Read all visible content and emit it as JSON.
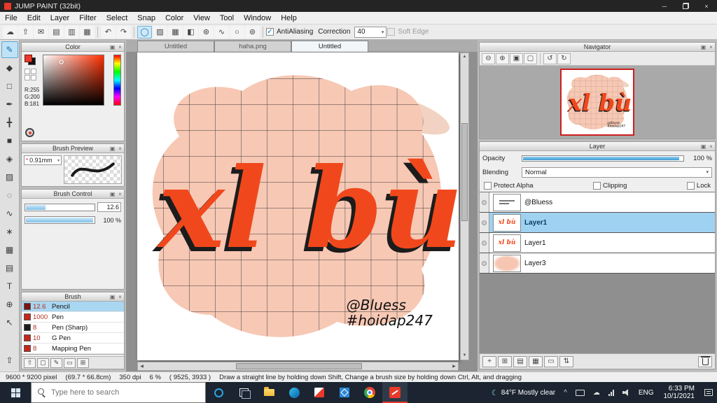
{
  "titlebar": {
    "title": "JUMP PAINT (32bit)"
  },
  "menu": [
    "File",
    "Edit",
    "Layer",
    "Filter",
    "Select",
    "Snap",
    "Color",
    "View",
    "Tool",
    "Window",
    "Help"
  ],
  "toolbar": {
    "antialiasing": "AntiAliasing",
    "correction": "Correction",
    "correction_value": "40",
    "soft_edge": "Soft Edge"
  },
  "tabs": [
    "Untitled",
    "haha.png",
    "Untitled"
  ],
  "panels": {
    "color": {
      "title": "Color",
      "r": "R:255",
      "g": "G:200",
      "b": "B:181"
    },
    "brush_preview": {
      "title": "Brush Preview",
      "size": "0.91mm"
    },
    "brush_control": {
      "title": "Brush Control",
      "size_value": "12.6",
      "opacity_value": "100 %"
    },
    "brush": {
      "title": "Brush",
      "items": [
        {
          "size": "12.6",
          "name": "Pencil"
        },
        {
          "size": "1000",
          "name": "Pen"
        },
        {
          "size": "8",
          "name": "Pen (Sharp)"
        },
        {
          "size": "10",
          "name": "G Pen"
        },
        {
          "size": "8",
          "name": "Mapping Pen"
        }
      ]
    },
    "navigator": {
      "title": "Navigator"
    },
    "layer": {
      "title": "Layer",
      "opacity_label": "Opacity",
      "opacity_value": "100 %",
      "blending_label": "Blending",
      "blending_value": "Normal",
      "protect_alpha": "Protect Alpha",
      "clipping": "Clipping",
      "lock": "Lock",
      "layers": [
        {
          "name": "@Bluess"
        },
        {
          "name": "Layer1"
        },
        {
          "name": "Layer1"
        },
        {
          "name": "Layer3"
        }
      ]
    }
  },
  "canvas": {
    "lettering": "xl bù",
    "signature1": "@Bluess",
    "signature2": "#hoidap247"
  },
  "statusbar": {
    "size": "9600 * 9200 pixel",
    "cm": "(69.7 * 66.8cm)",
    "dpi": "350 dpi",
    "zoom": "6 %",
    "coords": "( 9525, 3933 )",
    "hint": "Draw a straight line by holding down Shift, Change a brush size by holding down Ctrl, Alt, and dragging"
  },
  "taskbar": {
    "search_placeholder": "Type here to search",
    "weather": "84°F Mostly clear",
    "lang": "ENG",
    "time": "6:33 PM",
    "date": "10/1/2021"
  },
  "icons": {
    "cloud": "☁",
    "export": "⇧",
    "mail": "✉",
    "grid_a": "▤",
    "grid_b": "▥",
    "grid_c": "▦",
    "undo": "↶",
    "redo": "↷",
    "stabilizer": "◯",
    "gradient": "▨",
    "tone": "▦",
    "mirror": "◧",
    "material": "⊛",
    "curve": "∿",
    "ellipse": "○",
    "dial": "⊚",
    "check": "✓",
    "dropdown": "▾",
    "spin": "▾",
    "star": "*",
    "popout": "▣",
    "close": "×",
    "zoom_out": "⊖",
    "zoom_in": "⊕",
    "fit": "▣",
    "actual": "▢",
    "rotate_ccw": "↺",
    "rotate_cw": "↻",
    "up": "▲",
    "down": "▼",
    "left": "◀",
    "right": "▶",
    "add": "+",
    "folder_add": "⊞",
    "dup": "▤",
    "mat": "▦",
    "fold": "▭",
    "order": "⇅",
    "minimize": "─",
    "close_win": "×",
    "bf_up": "⇧",
    "bf_new": "▢",
    "bf_edit": "✎",
    "bf_doc": "▭",
    "bf_folder": "⊞",
    "moon": "☾",
    "chevron": "^",
    "tools": {
      "brush": "✎",
      "eraser": "◆",
      "select_rect": "□",
      "pen": "✒",
      "move": "╋",
      "shape": "■",
      "fill": "◈",
      "gradient": "▨",
      "select": "◌",
      "lasso": "∿",
      "magic_wand": "∗",
      "divide": "▦",
      "operation": "▤",
      "text": "T",
      "zoom": "⊕",
      "hand": "↖",
      "eyedropper": "◉",
      "up_box": "⇧"
    }
  }
}
